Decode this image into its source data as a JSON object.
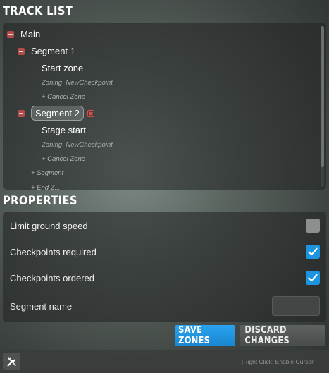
{
  "track_list": {
    "title": "TRACK LIST",
    "main_label": "Main",
    "segment1": {
      "label": "Segment 1",
      "zone": "Start zone",
      "zone_type": "Zoning_NewCheckpoint",
      "cancel": "+ Cancel Zone"
    },
    "segment2": {
      "label": "Segment 2",
      "zone": "Stage start",
      "zone_type": "Zoning_NewCheckpoint",
      "cancel": "+ Cancel Zone"
    },
    "add_segment": "+ Segment",
    "partial_next": "+ End Z..."
  },
  "properties": {
    "title": "PROPERTIES",
    "limit_ground_speed": {
      "label": "Limit ground speed",
      "checked": false
    },
    "checkpoints_required": {
      "label": "Checkpoints required",
      "checked": true
    },
    "checkpoints_ordered": {
      "label": "Checkpoints ordered",
      "checked": true
    },
    "segment_name": {
      "label": "Segment name",
      "value": ""
    }
  },
  "buttons": {
    "save": "SAVE ZONES",
    "discard": "DISCARD CHANGES"
  },
  "footer": {
    "hint": "[Right Click] Enable Cursor",
    "cursor_icon": "pencil-ruler-icon"
  },
  "colors": {
    "accent": "#1d94df",
    "delete": "#d24c4c",
    "collapse": "#b44b4b"
  }
}
